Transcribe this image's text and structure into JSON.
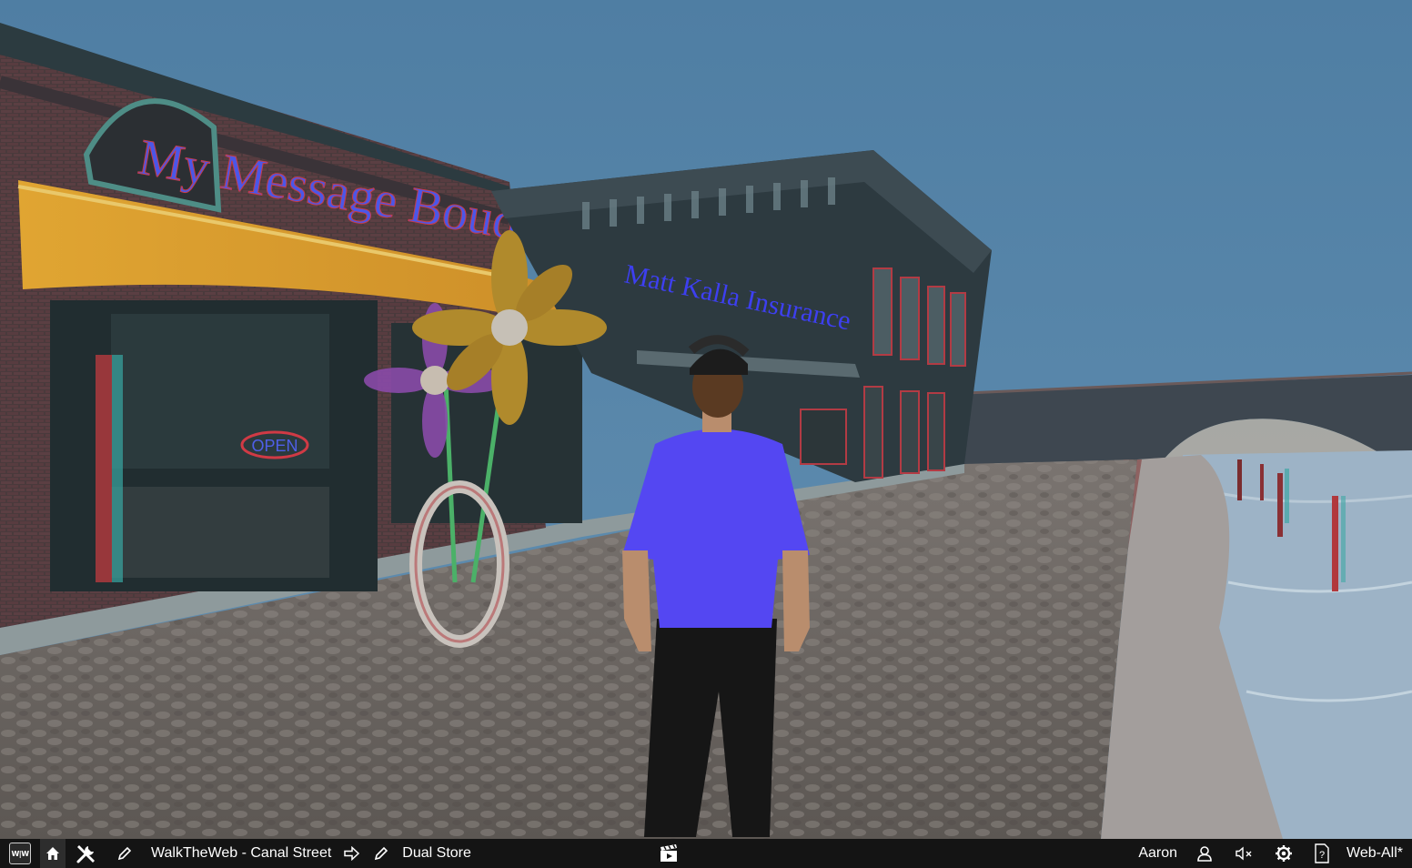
{
  "scene": {
    "store_sign": "My Message Bouquet",
    "insurance_sign": "Matt Kalla Insurance",
    "open_sign": "OPEN",
    "colors": {
      "sky": "#5583a8",
      "shirt": "#5447f2",
      "awning": "#e3a02a",
      "cobble": "#6e6a66",
      "water": "#9eb4c7"
    }
  },
  "toolbar": {
    "logo_label": "W|W",
    "community_name": "WalkTheWeb - Canal Street",
    "building_name": "Dual Store",
    "user_name": "Aaron",
    "web_mode": "Web-All*",
    "icons": [
      "walktheweb-logo-icon",
      "home-icon",
      "tools-icon",
      "pencil-icon",
      "arrow-right-icon",
      "pencil-icon",
      "clapperboard-icon",
      "user-icon",
      "mute-icon",
      "settings-gear-icon",
      "help-icon"
    ]
  }
}
